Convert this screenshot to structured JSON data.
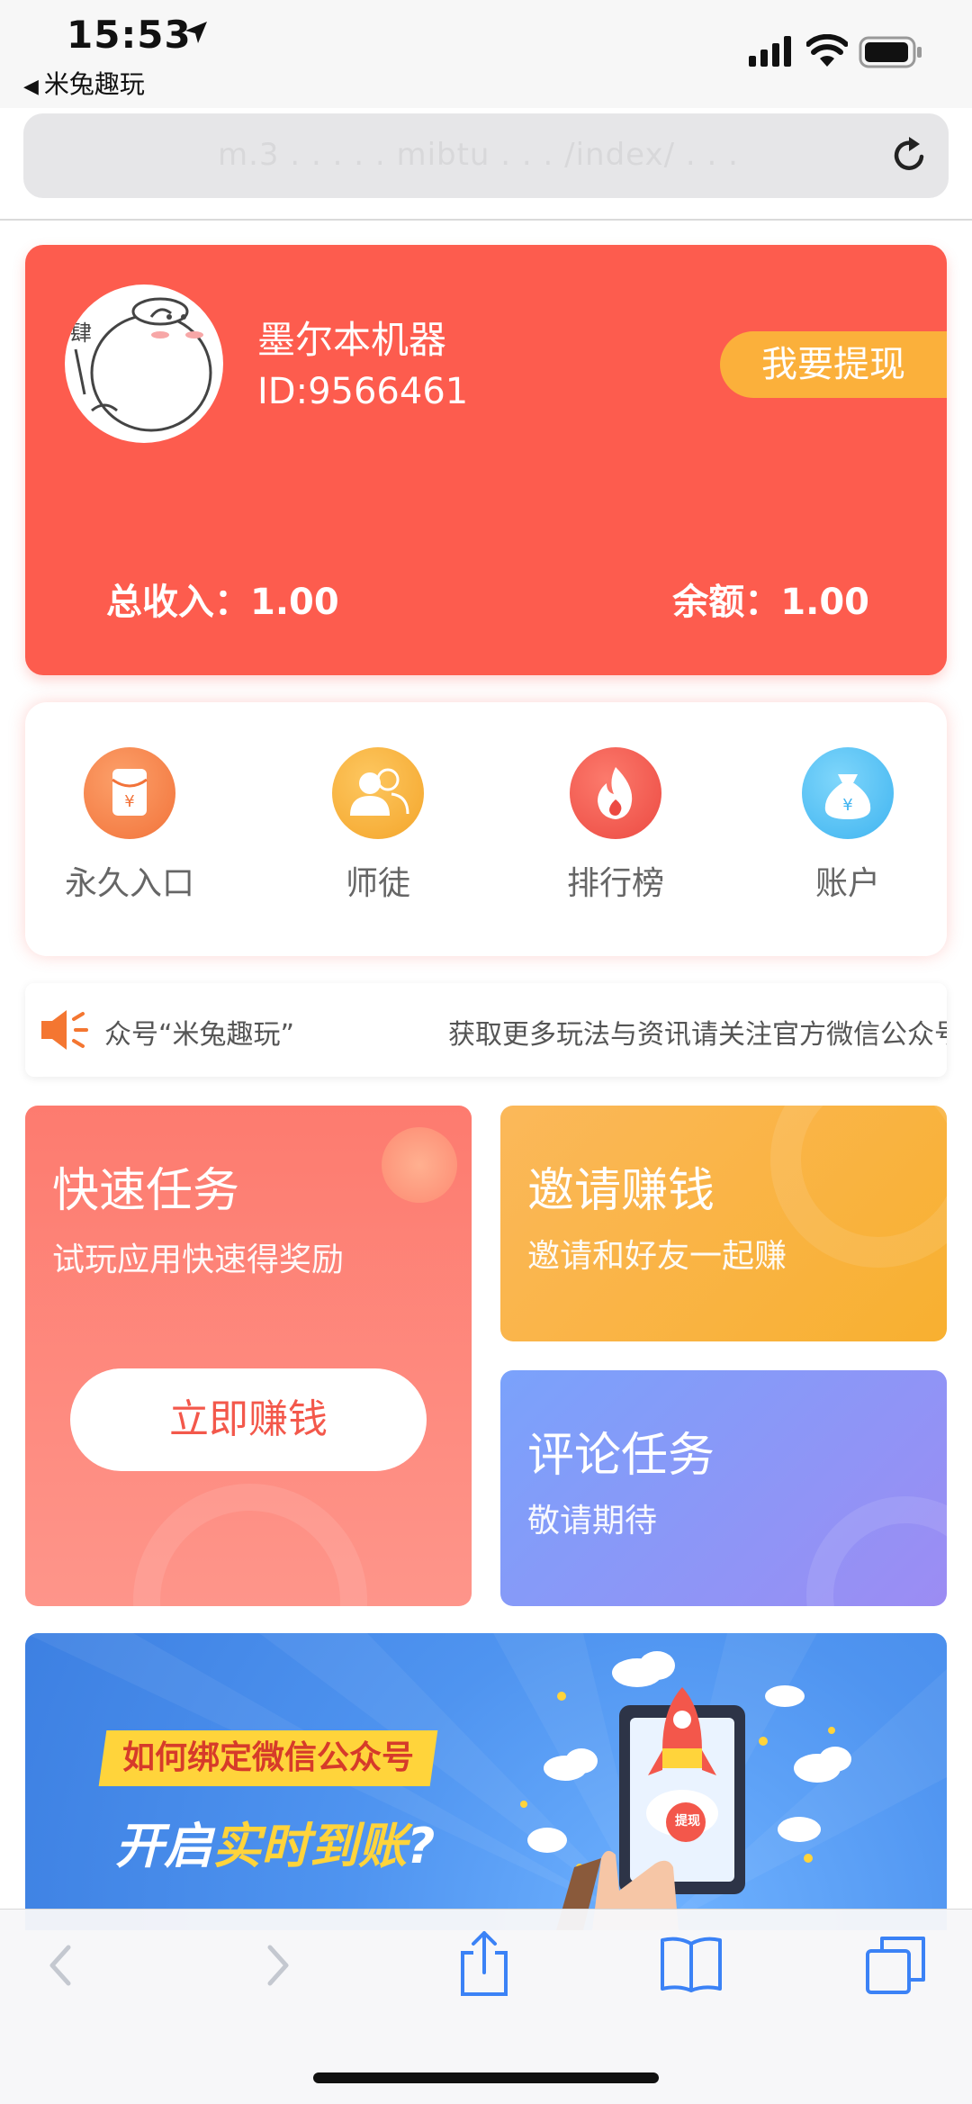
{
  "status": {
    "time": "15:53",
    "back_app": "米兔趣玩"
  },
  "browser": {
    "url_blurred": "m.3 . . . . . mibtu  . . . /index/ . . ."
  },
  "profile": {
    "nickname": "墨尔本机器",
    "id": "ID:9566461",
    "withdraw_label": "我要提现",
    "total_income": "总收入：1.00",
    "balance": "余额：1.00"
  },
  "menu": {
    "items": [
      {
        "label": "永久入口",
        "icon": "red-envelope-icon",
        "color": "#f8844a"
      },
      {
        "label": "师徒",
        "icon": "users-icon",
        "color": "#fbb03b"
      },
      {
        "label": "排行榜",
        "icon": "flame-icon",
        "color": "#f7584f"
      },
      {
        "label": "账户",
        "icon": "money-bag-icon",
        "color": "#52c1f5"
      }
    ]
  },
  "notice": {
    "part1": "众号“米兔趣玩”",
    "part2": "获取更多玩法与资讯请关注官方微信公众号"
  },
  "tasks": {
    "fast": {
      "title": "快速任务",
      "subtitle": "试玩应用快速得奖励",
      "button": "立即赚钱"
    },
    "invite": {
      "title": "邀请赚钱",
      "subtitle": "邀请和好友一起赚"
    },
    "comment": {
      "title": "评论任务",
      "subtitle": "敬请期待"
    }
  },
  "banner": {
    "tag": "如何绑定微信公众号",
    "main_prefix": "开启",
    "main_highlight": "实时到账",
    "main_suffix": "?",
    "rocket_label": "提现"
  },
  "colors": {
    "primary_red": "#fd5c4e",
    "accent_yellow": "#fbb03b",
    "accent_purple": "#9c8cf3"
  }
}
